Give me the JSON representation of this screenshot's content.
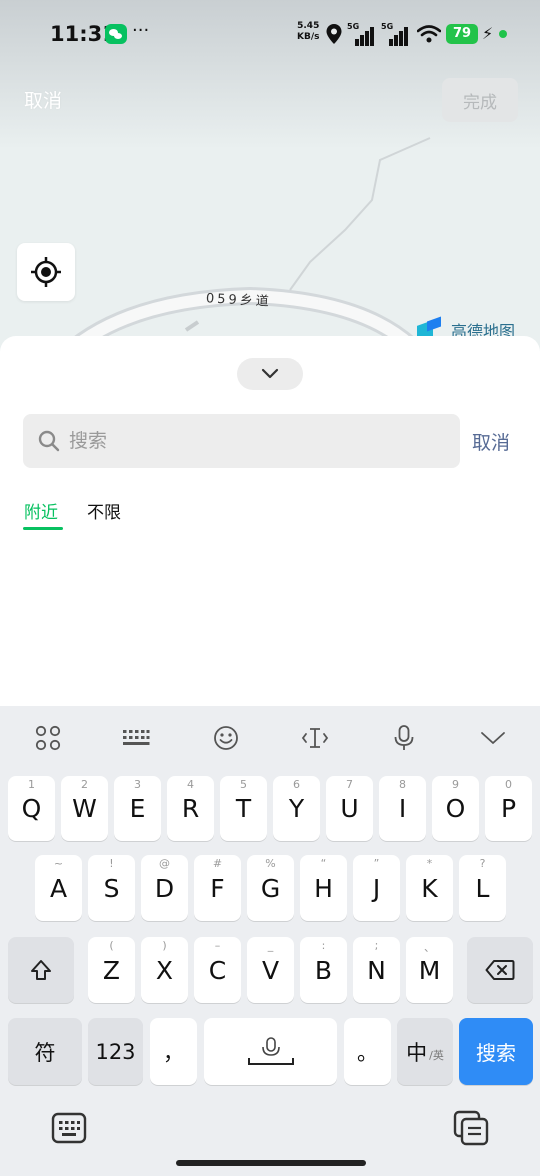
{
  "status_bar": {
    "time": "11:31",
    "more": "···",
    "net_speed_value": "5.45",
    "net_speed_unit": "KB/s",
    "signal1": "5G",
    "signal2": "5G",
    "battery": "79"
  },
  "map": {
    "road_label": "059乡道",
    "brand": "高德地图"
  },
  "header": {
    "cancel_label": "取消",
    "done_label": "完成"
  },
  "search": {
    "placeholder": "搜索",
    "cancel_label": "取消"
  },
  "tabs": [
    {
      "label": "附近",
      "active": true
    },
    {
      "label": "不限",
      "active": false
    }
  ],
  "keyboard": {
    "row1": [
      {
        "key": "Q",
        "hint": "1"
      },
      {
        "key": "W",
        "hint": "2"
      },
      {
        "key": "E",
        "hint": "3"
      },
      {
        "key": "R",
        "hint": "4"
      },
      {
        "key": "T",
        "hint": "5"
      },
      {
        "key": "Y",
        "hint": "6"
      },
      {
        "key": "U",
        "hint": "7"
      },
      {
        "key": "I",
        "hint": "8"
      },
      {
        "key": "O",
        "hint": "9"
      },
      {
        "key": "P",
        "hint": "0"
      }
    ],
    "row2": [
      {
        "key": "A",
        "hint": "~"
      },
      {
        "key": "S",
        "hint": "!"
      },
      {
        "key": "D",
        "hint": "@"
      },
      {
        "key": "F",
        "hint": "#"
      },
      {
        "key": "G",
        "hint": "%"
      },
      {
        "key": "H",
        "hint": "“"
      },
      {
        "key": "J",
        "hint": "”"
      },
      {
        "key": "K",
        "hint": "*"
      },
      {
        "key": "L",
        "hint": "?"
      }
    ],
    "row3": [
      {
        "key": "Z",
        "hint": "("
      },
      {
        "key": "X",
        "hint": ")"
      },
      {
        "key": "C",
        "hint": "–"
      },
      {
        "key": "V",
        "hint": "_"
      },
      {
        "key": "B",
        "hint": ":"
      },
      {
        "key": "N",
        "hint": ";"
      },
      {
        "key": "M",
        "hint": "、"
      }
    ],
    "symbols_label": "符",
    "numbers_label": "123",
    "comma_label": "，",
    "period_label": "。",
    "chinese_label": "中",
    "english_sub": "/英",
    "search_label": "搜索"
  },
  "colors": {
    "accent_green": "#07c160",
    "link_blue": "#576b95",
    "search_key_blue": "#2f8cf6"
  }
}
